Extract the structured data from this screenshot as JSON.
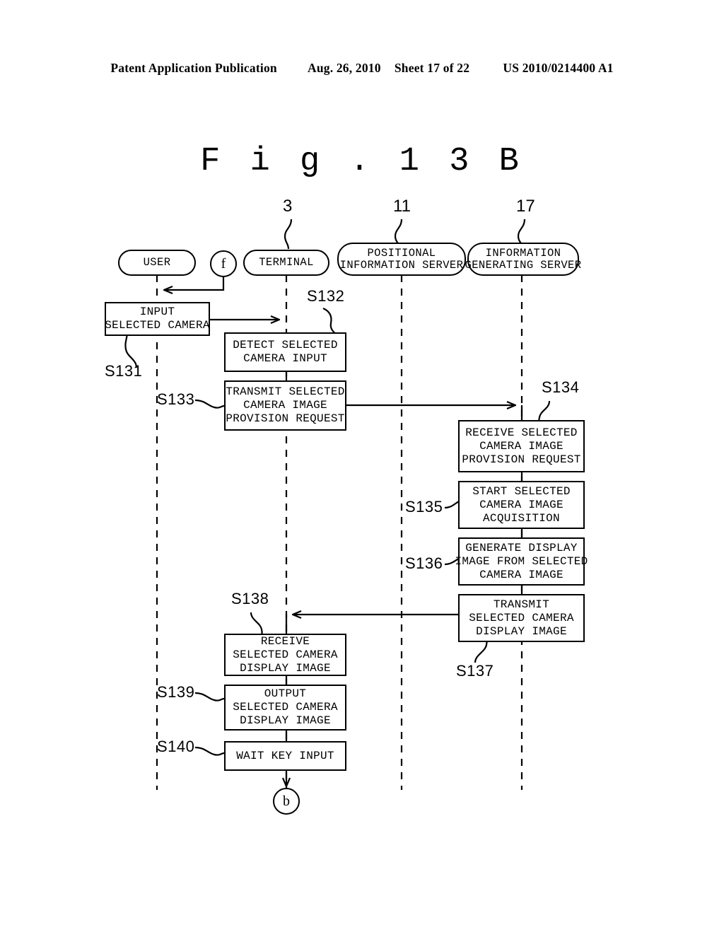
{
  "header": {
    "publication": "Patent Application Publication",
    "date": "Aug. 26, 2010",
    "sheet": "Sheet 17 of 22",
    "patent_number": "US 2010/0214400 A1"
  },
  "figure": {
    "title": "F i g . 1 3 B"
  },
  "lifelines": [
    {
      "id": "user",
      "label_lines": [
        "USER"
      ],
      "ref": null
    },
    {
      "id": "terminal",
      "label_lines": [
        "TERMINAL"
      ],
      "ref": "3"
    },
    {
      "id": "positional",
      "label_lines": [
        "POSITIONAL",
        "INFORMATION SERVER"
      ],
      "ref": "11"
    },
    {
      "id": "infogen",
      "label_lines": [
        "INFORMATION",
        "GENERATING SERVER"
      ],
      "ref": "17"
    }
  ],
  "connectors": {
    "entry": "f",
    "exit": "b"
  },
  "steps": [
    {
      "id": "S131",
      "label": "S131",
      "lane": "user",
      "lines": [
        "INPUT",
        "SELECTED CAMERA"
      ]
    },
    {
      "id": "S132",
      "label": "S132",
      "lane": "terminal",
      "lines": [
        "DETECT SELECTED",
        "CAMERA INPUT"
      ]
    },
    {
      "id": "S133",
      "label": "S133",
      "lane": "terminal",
      "lines": [
        "TRANSMIT SELECTED",
        "CAMERA IMAGE",
        "PROVISION REQUEST"
      ]
    },
    {
      "id": "S134",
      "label": "S134",
      "lane": "infogen",
      "lines": [
        "RECEIVE SELECTED",
        "CAMERA IMAGE",
        "PROVISION REQUEST"
      ]
    },
    {
      "id": "S135",
      "label": "S135",
      "lane": "infogen",
      "lines": [
        "START SELECTED",
        "CAMERA IMAGE",
        "ACQUISITION"
      ]
    },
    {
      "id": "S136",
      "label": "S136",
      "lane": "infogen",
      "lines": [
        "GENERATE DISPLAY",
        "IMAGE FROM SELECTED",
        "CAMERA IMAGE"
      ]
    },
    {
      "id": "S137",
      "label": "S137",
      "lane": "infogen",
      "lines": [
        "TRANSMIT",
        "SELECTED CAMERA",
        "DISPLAY IMAGE"
      ]
    },
    {
      "id": "S138",
      "label": "S138",
      "lane": "terminal",
      "lines": [
        "RECEIVE",
        "SELECTED CAMERA",
        "DISPLAY IMAGE"
      ]
    },
    {
      "id": "S139",
      "label": "S139",
      "lane": "terminal",
      "lines": [
        "OUTPUT",
        "SELECTED CAMERA",
        "DISPLAY IMAGE"
      ]
    },
    {
      "id": "S140",
      "label": "S140",
      "lane": "terminal",
      "lines": [
        "WAIT KEY INPUT"
      ]
    }
  ]
}
